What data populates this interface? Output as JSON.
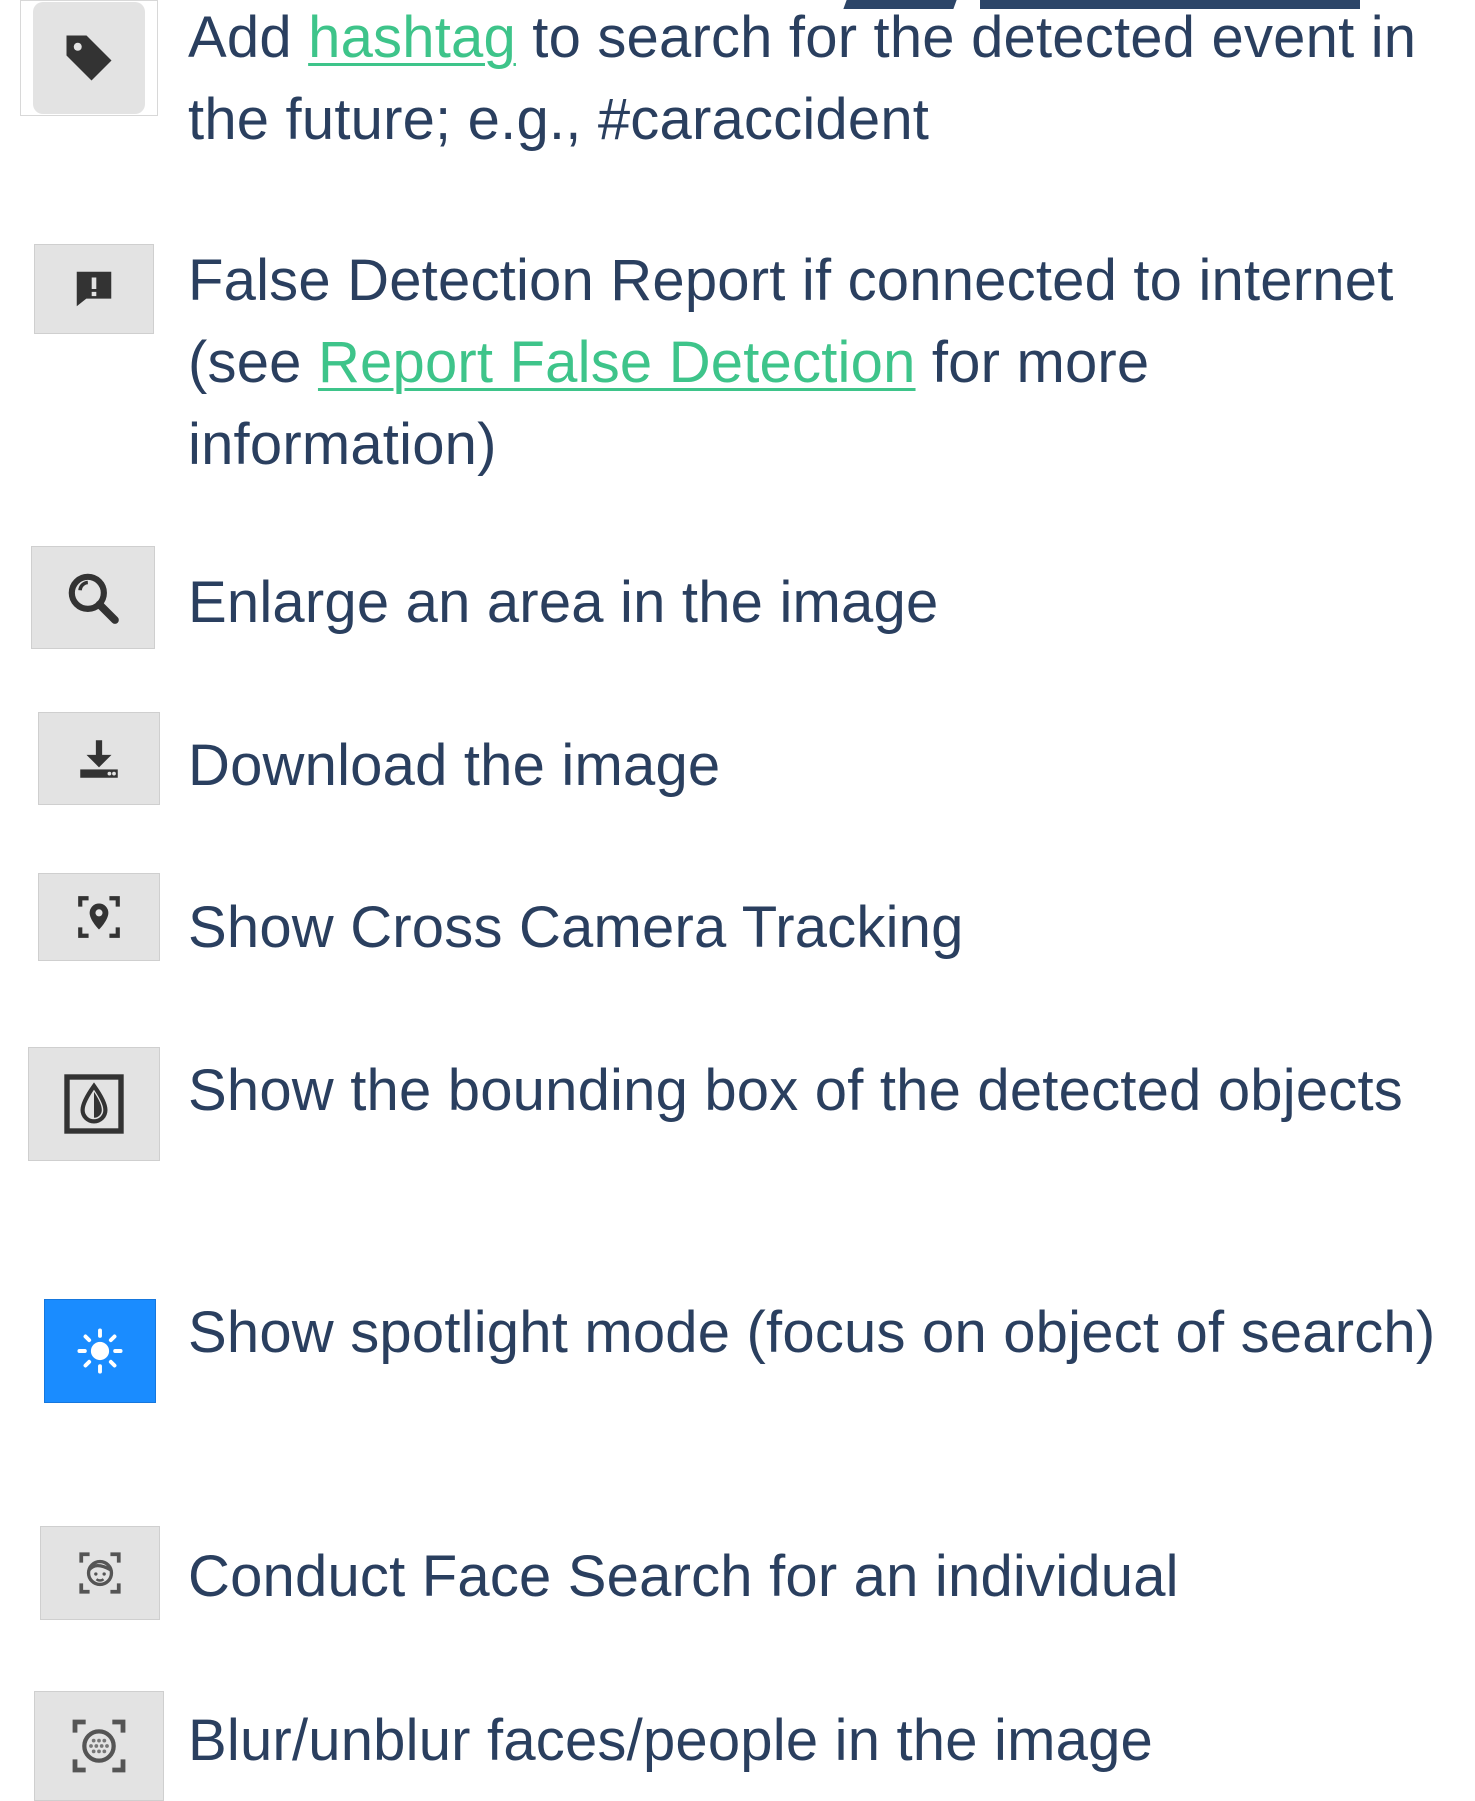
{
  "colors": {
    "text": "#2a3f5f",
    "link": "#3ec48a",
    "icon_bg": "#e3e3e3",
    "spotlight_bg": "#1a8cff"
  },
  "items": [
    {
      "icon": "tag-icon",
      "before": "Add ",
      "link": "hashtag",
      "after": " to search for the detected event in the future; e.g., #caraccident"
    },
    {
      "icon": "report-exclamation-icon",
      "before": "False Detection Report if connected to internet (see ",
      "link": "Report False Detection",
      "after": " for more information)"
    },
    {
      "icon": "magnifier-icon",
      "text": "Enlarge an area in the image"
    },
    {
      "icon": "download-icon",
      "text": "Download the image"
    },
    {
      "icon": "cross-camera-tracking-icon",
      "text": "Show Cross Camera Tracking"
    },
    {
      "icon": "bounding-box-icon",
      "text": "Show the bounding box of the detected objects"
    },
    {
      "icon": "spotlight-sun-icon",
      "text": "Show spotlight mode (focus on object of search)"
    },
    {
      "icon": "face-search-icon",
      "text": "Conduct Face Search for an individual"
    },
    {
      "icon": "blur-face-icon",
      "text": "Blur/unblur faces/people in the image"
    }
  ]
}
